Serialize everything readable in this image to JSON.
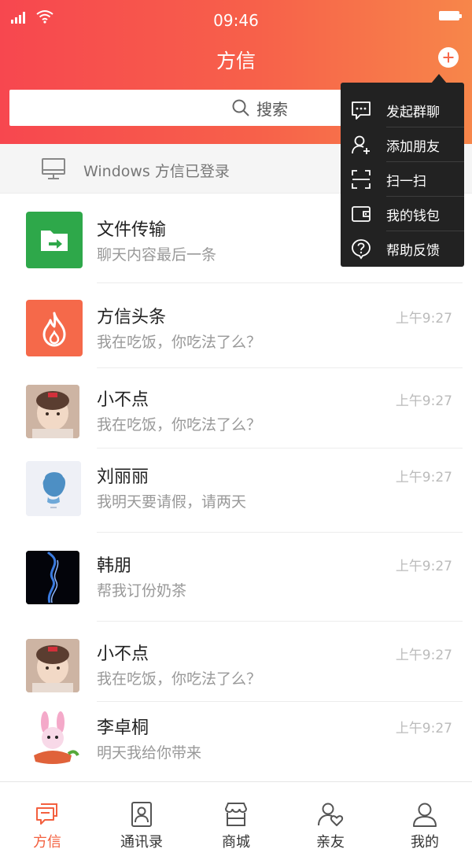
{
  "status_bar": {
    "time": "09:46"
  },
  "header": {
    "title": "方信"
  },
  "search": {
    "label": "搜索"
  },
  "login_banner": {
    "text": "Windows 方信已登录"
  },
  "popup_menu": [
    {
      "icon": "chat-bubble-icon",
      "label": "发起群聊"
    },
    {
      "icon": "add-friend-icon",
      "label": "添加朋友"
    },
    {
      "icon": "scan-icon",
      "label": "扫一扫"
    },
    {
      "icon": "wallet-icon",
      "label": "我的钱包"
    },
    {
      "icon": "help-icon",
      "label": "帮助反馈"
    }
  ],
  "chats": [
    {
      "name": "文件传输",
      "preview": "聊天内容最后一条",
      "time": ""
    },
    {
      "name": "方信头条",
      "preview": "我在吃饭，你吃法了么？",
      "time": "上午9:27"
    },
    {
      "name": "小不点",
      "preview": "我在吃饭，你吃法了么？",
      "time": "上午9:27"
    },
    {
      "name": "刘丽丽",
      "preview": "我明天要请假，请两天",
      "time": "上午9:27"
    },
    {
      "name": "韩朋",
      "preview": "帮我订份奶茶",
      "time": "上午9:27"
    },
    {
      "name": "小不点",
      "preview": "我在吃饭，你吃法了么？",
      "time": "上午9:27"
    },
    {
      "name": "李卓桐",
      "preview": "明天我给你带来",
      "time": "上午9:27"
    }
  ],
  "tabs": [
    {
      "label": "方信",
      "icon": "chat-icon",
      "active": true
    },
    {
      "label": "通讯录",
      "icon": "contacts-icon",
      "active": false
    },
    {
      "label": "商城",
      "icon": "store-icon",
      "active": false
    },
    {
      "label": "亲友",
      "icon": "family-icon",
      "active": false
    },
    {
      "label": "我的",
      "icon": "profile-icon",
      "active": false
    }
  ],
  "colors": {
    "header_gradient_start": "#f7474f",
    "header_gradient_end": "#f7864a",
    "accent": "#f3603f",
    "file_transfer_green": "#2ea84a",
    "headline_orange": "#f5694a",
    "popup_bg": "#222222"
  }
}
